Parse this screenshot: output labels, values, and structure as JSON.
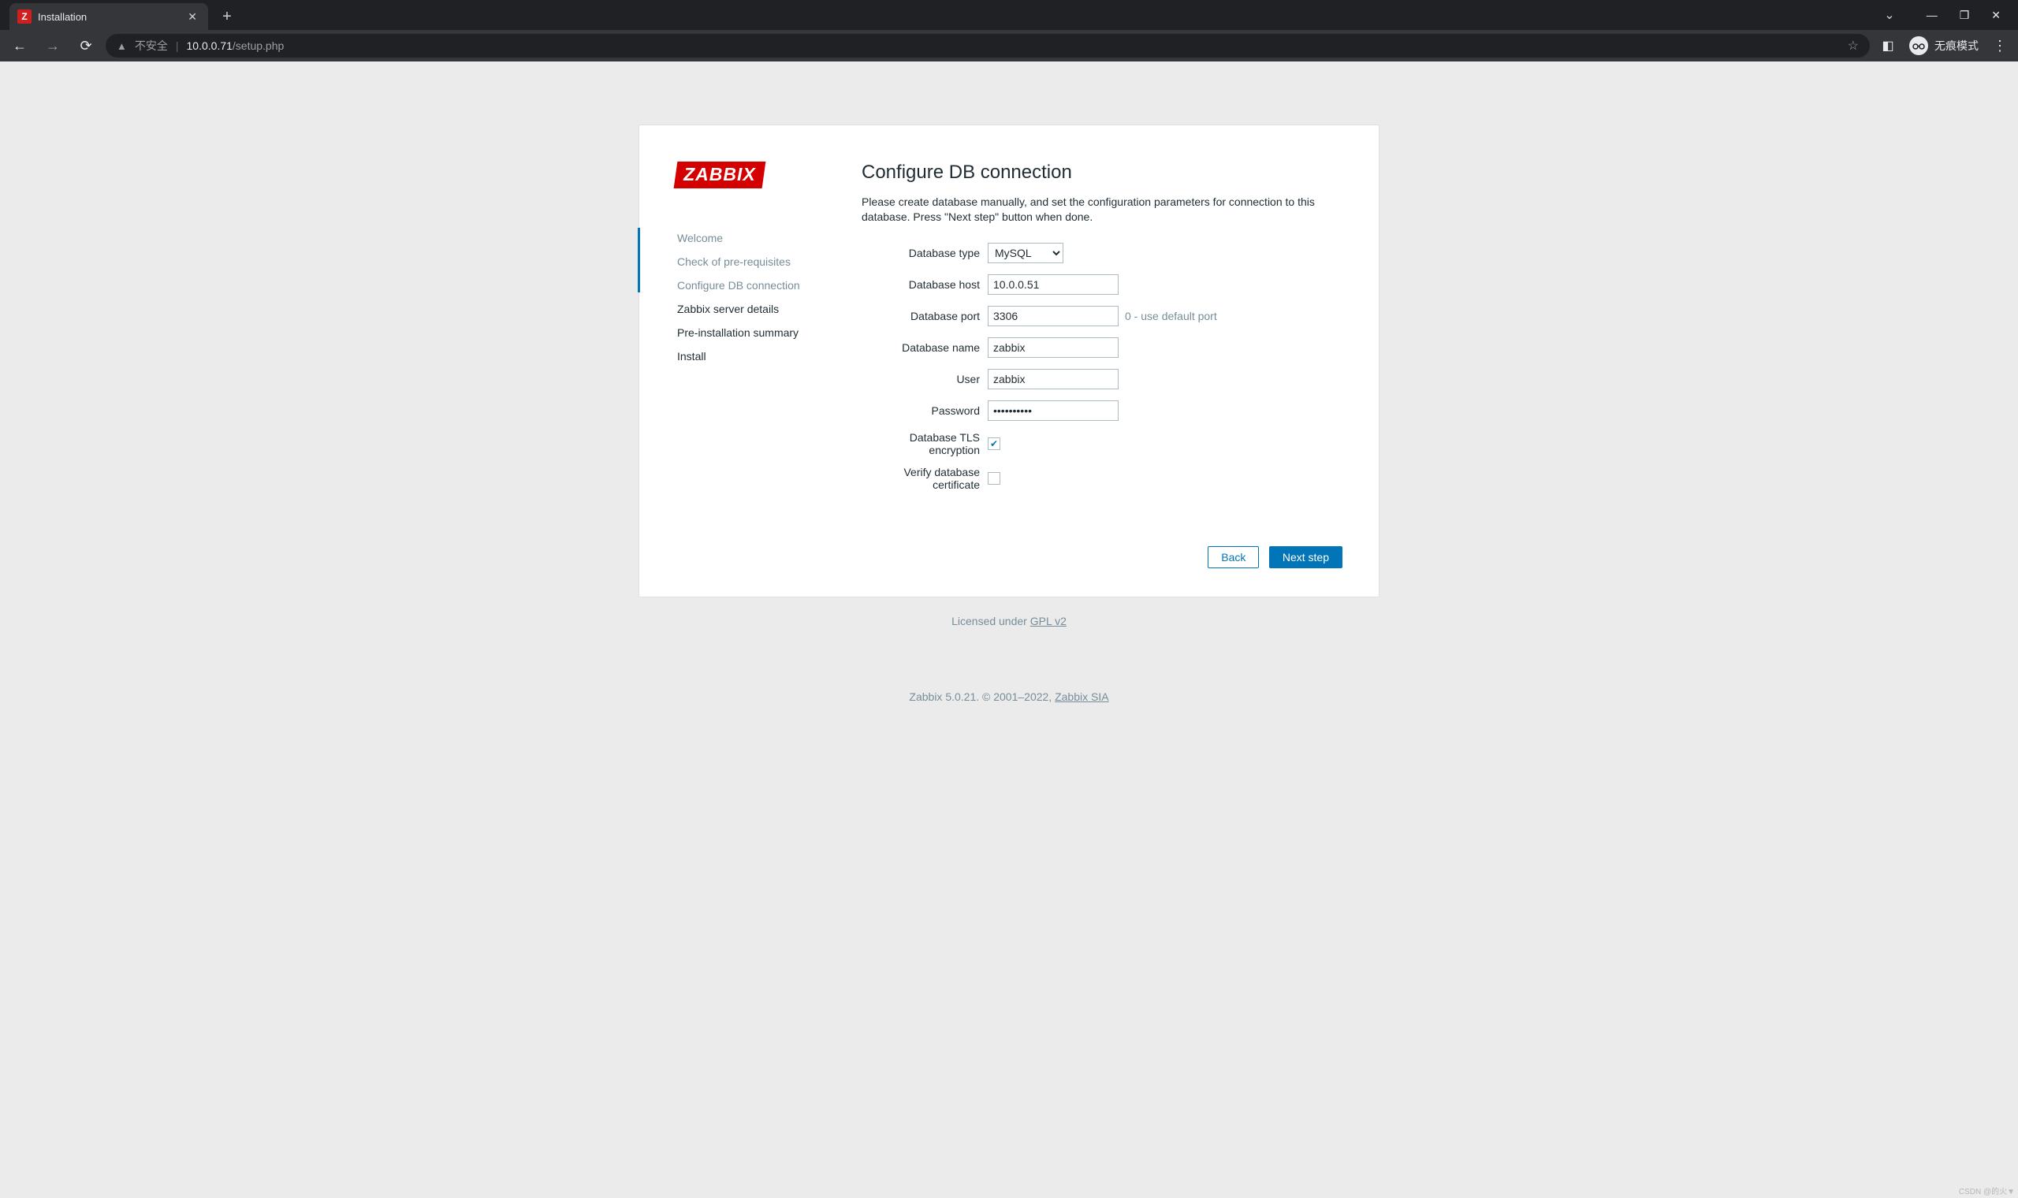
{
  "browser": {
    "tab_title": "Installation",
    "favicon_letter": "Z",
    "security_label": "不安全",
    "url_host": "10.0.0.71",
    "url_path": "/setup.php",
    "incognito_label": "无痕模式"
  },
  "logo_text": "ZABBIX",
  "steps": [
    {
      "label": "Welcome",
      "state": "done"
    },
    {
      "label": "Check of pre-requisites",
      "state": "done"
    },
    {
      "label": "Configure DB connection",
      "state": "current"
    },
    {
      "label": "Zabbix server details",
      "state": "todo"
    },
    {
      "label": "Pre-installation summary",
      "state": "todo"
    },
    {
      "label": "Install",
      "state": "todo"
    }
  ],
  "main": {
    "heading": "Configure DB connection",
    "description": "Please create database manually, and set the configuration parameters for connection to this database. Press \"Next step\" button when done.",
    "labels": {
      "db_type": "Database type",
      "db_host": "Database host",
      "db_port": "Database port",
      "db_name": "Database name",
      "user": "User",
      "password": "Password",
      "tls": "Database TLS encryption",
      "verify_cert": "Verify database certificate"
    },
    "values": {
      "db_type": "MySQL",
      "db_host": "10.0.0.51",
      "db_port": "3306",
      "db_name": "zabbix",
      "user": "zabbix",
      "password": "••••••••••",
      "tls_checked": true,
      "verify_cert_checked": false
    },
    "db_port_hint": "0 - use default port",
    "buttons": {
      "back": "Back",
      "next": "Next step"
    }
  },
  "license": {
    "prefix": "Licensed under ",
    "link": "GPL v2"
  },
  "footer": {
    "text_prefix": "Zabbix 5.0.21. © 2001–2022, ",
    "link": "Zabbix SIA"
  },
  "watermark": "CSDN @的火▼"
}
